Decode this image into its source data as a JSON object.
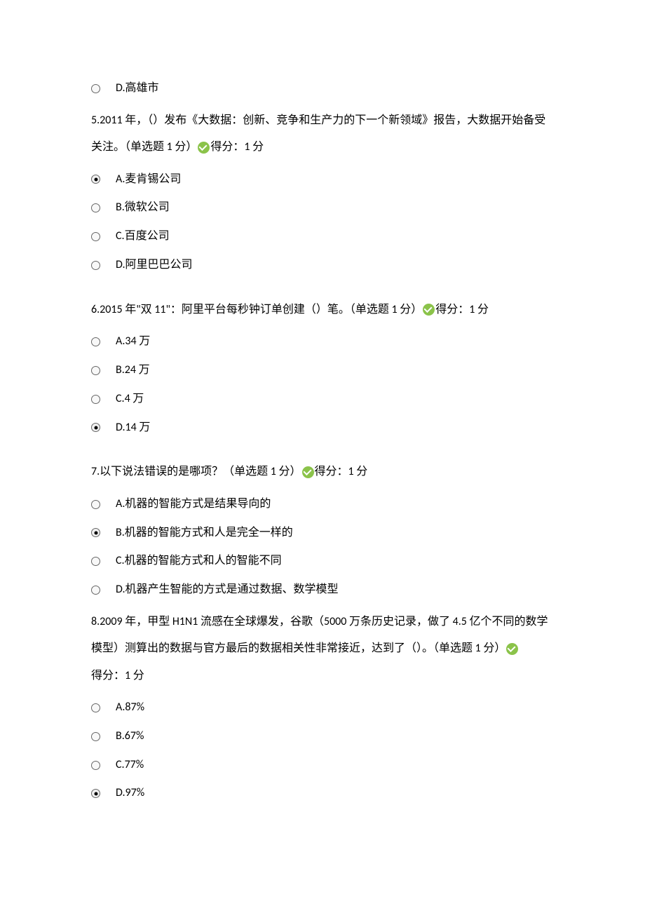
{
  "q4": {
    "options": {
      "d": "D.高雄市"
    }
  },
  "q5": {
    "text_before": "5.2011 年，（）发布《大数据：创新、竞争和生产力的下一个新领域》报告，大数据开始备受关注。（单选题 1 分）",
    "score": "得分：1 分",
    "options": {
      "a": "A.麦肯锡公司",
      "b": "B.微软公司",
      "c": "C.百度公司",
      "d": "D.阿里巴巴公司"
    },
    "selected": "a"
  },
  "q6": {
    "text_before": "6.2015 年\"双 11\"：阿里平台每秒钟订单创建（）笔。（单选题 1 分）",
    "score": "得分：1 分",
    "options": {
      "a": "A.34 万",
      "b": "B.24 万",
      "c": "C.4 万",
      "d": "D.14 万"
    },
    "selected": "d"
  },
  "q7": {
    "text_before": "7.以下说法错误的是哪项？（单选题 1 分）",
    "score": "得分：1 分",
    "options": {
      "a": "A.机器的智能方式是结果导向的",
      "b": "B.机器的智能方式和人是完全一样的",
      "c": "C.机器的智能方式和人的智能不同",
      "d": "D.机器产生智能的方式是通过数据、数学模型"
    },
    "selected": "b"
  },
  "q8": {
    "text_before": "8.2009 年，甲型 H1N1 流感在全球爆发，谷歌（5000 万条历史记录，做了 4.5 亿个不同的数学模型）测算出的数据与官方最后的数据相关性非常接近，达到了（）。（单选题 1 分）",
    "score": "得分：1 分",
    "options": {
      "a": "A.87%",
      "b": "B.67%",
      "c": "C.77%",
      "d": "D.97%"
    },
    "selected": "d"
  }
}
